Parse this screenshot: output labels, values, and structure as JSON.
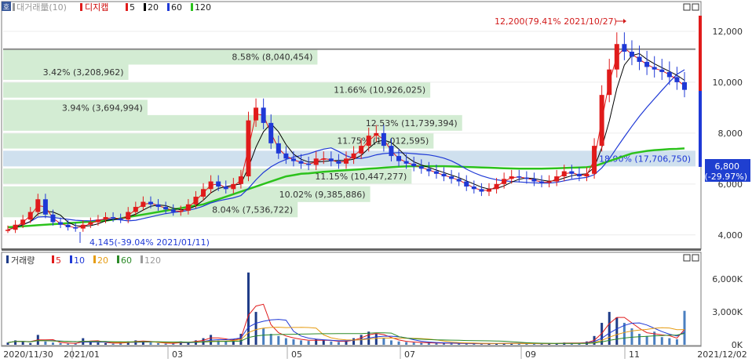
{
  "top_legend": {
    "label_a": "대거래量(10)",
    "label_b": "디지캡",
    "ma": [
      "5",
      "20",
      "60",
      "120"
    ],
    "ma_colors": [
      "#e01b1b",
      "#000000",
      "#1f39d6",
      "#2cc21c"
    ]
  },
  "vol_legend": {
    "label": "거래량",
    "ma": [
      "5",
      "10",
      "20",
      "60",
      "120"
    ],
    "ma_colors": [
      "#e01b1b",
      "#1f39d6",
      "#e69c13",
      "#2c8a28",
      "#9a9a9a"
    ]
  },
  "badges": {
    "tl": "호"
  },
  "annotations": {
    "high": "12,200(79.41% 2021/10/27)",
    "low": "4,145(-39.04% 2021/01/11)",
    "current_price": "6,800",
    "current_change": "(-29.97%)"
  },
  "volume_profile": [
    {
      "price": 11000,
      "label": "8.58% (8,040,454)",
      "share": 8.58
    },
    {
      "price": 10400,
      "label": "3.42% (3,208,962)",
      "share": 3.42
    },
    {
      "price": 9700,
      "label": "11.66% (10,926,025)",
      "share": 11.66
    },
    {
      "price": 9000,
      "label": "3.94% (3,694,994)",
      "share": 3.94
    },
    {
      "price": 8400,
      "label": "12.53% (11,739,394)",
      "share": 12.53
    },
    {
      "price": 7700,
      "label": "11.75% (11,012,595)",
      "share": 11.75
    },
    {
      "price": 7000,
      "label": "18.90% (17,706,750)",
      "share": 18.9
    },
    {
      "price": 6300,
      "label": "11.15% (10,447,277)",
      "share": 11.15
    },
    {
      "price": 5600,
      "label": "10.02% (9,385,886)",
      "share": 10.02
    },
    {
      "price": 5000,
      "label": "8.04% (7,536,722)",
      "share": 8.04
    }
  ],
  "chart_data": {
    "type": "candlestick",
    "price_axis": {
      "ticks": [
        "4,000",
        "6,000",
        "8,000",
        "10,000",
        "12,000"
      ],
      "values": [
        4000,
        6000,
        8000,
        10000,
        12000
      ],
      "ylim": [
        3500,
        12800
      ]
    },
    "volume_axis": {
      "ticks": [
        "0K",
        "3,000K",
        "6,000K"
      ],
      "values": [
        0,
        3000,
        6000
      ],
      "ylim": [
        0,
        7300
      ]
    },
    "x_labels": [
      "2020/11/30",
      "2021/01",
      "03",
      "05",
      "07",
      "09",
      "11",
      "2021/12/02"
    ],
    "price_series": [
      4200,
      4400,
      4600,
      4900,
      5400,
      4800,
      4500,
      4400,
      4300,
      4250,
      4400,
      4500,
      4600,
      4700,
      4650,
      4600,
      4900,
      5100,
      5300,
      5200,
      5100,
      5000,
      4900,
      4950,
      5200,
      5500,
      5800,
      6100,
      5900,
      5800,
      6000,
      6300,
      8500,
      9000,
      8400,
      7600,
      7200,
      7000,
      6900,
      6800,
      6750,
      7000,
      7000,
      6900,
      6800,
      7000,
      7200,
      7500,
      7900,
      8000,
      7500,
      7100,
      6900,
      6800,
      6700,
      6600,
      6500,
      6400,
      6300,
      6200,
      6100,
      5900,
      5800,
      5700,
      5800,
      6000,
      6200,
      6300,
      6250,
      6200,
      6100,
      6050,
      6100,
      6300,
      6500,
      6400,
      6300,
      6400,
      7500,
      9500,
      10500,
      11500,
      11200,
      11000,
      10800,
      10600,
      10500,
      10400,
      10200,
      10000,
      9700
    ],
    "ma120": [
      4300,
      4320,
      4340,
      4360,
      4380,
      4400,
      4420,
      4440,
      4460,
      4480,
      4500,
      4520,
      4540,
      4560,
      4600,
      4650,
      4700,
      4750,
      4800,
      4850,
      4900,
      4950,
      5000,
      5050,
      5100,
      5150,
      5200,
      5300,
      5400,
      5500,
      5600,
      5700,
      5800,
      5900,
      6000,
      6100,
      6200,
      6300,
      6350,
      6400,
      6420,
      6450,
      6480,
      6500,
      6520,
      6540,
      6560,
      6580,
      6600,
      6620,
      6640,
      6660,
      6680,
      6690,
      6700,
      6700,
      6700,
      6700,
      6700,
      6690,
      6680,
      6670,
      6660,
      6650,
      6640,
      6630,
      6620,
      6610,
      6600,
      6600,
      6600,
      6600,
      6610,
      6620,
      6630,
      6640,
      6650,
      6660,
      6700,
      6800,
      6900,
      7000,
      7100,
      7200,
      7250,
      7300,
      7330,
      7350,
      7370,
      7380,
      7400
    ],
    "volumes": [
      200,
      400,
      300,
      150,
      900,
      300,
      200,
      150,
      100,
      120,
      600,
      300,
      200,
      150,
      100,
      200,
      300,
      400,
      300,
      200,
      150,
      100,
      150,
      300,
      200,
      400,
      600,
      900,
      400,
      300,
      500,
      1000,
      6600,
      3000,
      1500,
      1000,
      800,
      600,
      500,
      400,
      350,
      500,
      400,
      300,
      250,
      400,
      600,
      900,
      1200,
      1000,
      600,
      400,
      300,
      250,
      200,
      180,
      160,
      150,
      140,
      130,
      120,
      110,
      100,
      100,
      110,
      120,
      150,
      130,
      120,
      100,
      100,
      90,
      100,
      150,
      200,
      150,
      120,
      300,
      800,
      2000,
      3000,
      2500,
      2000,
      1500,
      1000,
      800,
      1200,
      700,
      600,
      500,
      3100
    ]
  }
}
